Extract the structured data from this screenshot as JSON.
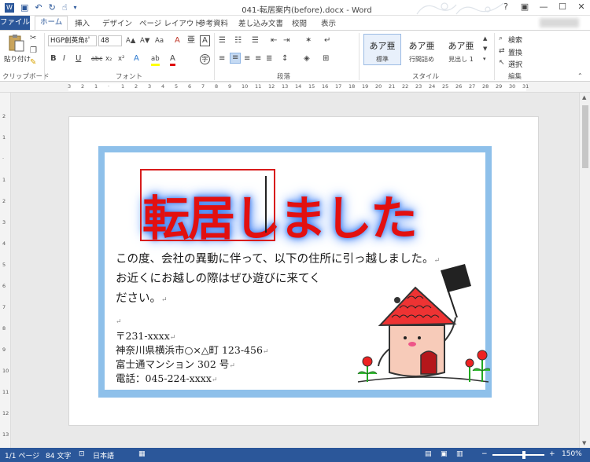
{
  "window": {
    "title": "041-転居案内(before).docx - Word",
    "help": "?",
    "ribbon_display": "▣",
    "minimize": "—",
    "maximize": "☐",
    "close": "✕"
  },
  "qat": {
    "save": "▣",
    "undo": "↶",
    "redo": "↻",
    "touch": "☝",
    "customize": "▾"
  },
  "tabs": [
    "ファイル",
    "ホーム",
    "挿入",
    "デザイン",
    "ページ レイアウト",
    "参考資料",
    "差し込み文書",
    "校閲",
    "表示"
  ],
  "active_tab": "ホーム",
  "ribbon": {
    "clipboard": {
      "paste": "貼り付け",
      "label": "クリップボード"
    },
    "font": {
      "family": "HGP創英角ﾎﾟ",
      "size": "48",
      "label": "フォント",
      "grow": "A▲",
      "shrink": "A▼",
      "case": "Aa",
      "clear": "A",
      "phonetic": "亜",
      "border": "A",
      "bold": "B",
      "italic": "I",
      "underline": "U",
      "strike": "abc",
      "sub": "x₂",
      "sup": "x²",
      "effects": "A",
      "highlight": "ab",
      "color": "A",
      "enclose": "字"
    },
    "paragraph": {
      "label": "段落"
    },
    "styles": {
      "label": "スタイル",
      "items": [
        {
          "sample": "あア亜",
          "name": "標準"
        },
        {
          "sample": "あア亜",
          "name": "行間詰め"
        },
        {
          "sample": "あア亜",
          "name": "見出し 1"
        }
      ]
    },
    "editing": {
      "label": "編集",
      "find": "検索",
      "replace": "置換",
      "select": "選択"
    }
  },
  "ruler": [
    "3",
    "2",
    "1",
    "",
    "1",
    "2",
    "3",
    "4",
    "5",
    "6",
    "7",
    "8",
    "9",
    "10",
    "11",
    "12",
    "13",
    "14",
    "15",
    "16",
    "17",
    "18",
    "19",
    "20",
    "21",
    "22",
    "23",
    "24",
    "25",
    "26",
    "27",
    "28",
    "29",
    "30",
    "31"
  ],
  "vruler": [
    "2",
    "1",
    "",
    "1",
    "2",
    "3",
    "4",
    "5",
    "6",
    "7",
    "8",
    "9",
    "10",
    "11",
    "12",
    "13"
  ],
  "document": {
    "headline": "転居しました",
    "body_line1": "この度、会社の異動に伴って、以下の住所に引っ越しました。",
    "body_line2": "お近くにお越しの際はぜひ遊びに来てく",
    "body_line3": "ださい。",
    "postal": "〒231-xxxx",
    "address": "神奈川県横浜市○×△町 123-456",
    "building": "富士通マンション 302 号",
    "phone": "電話：045-224-xxxx",
    "para_mark": "↵"
  },
  "status": {
    "page": "1/1 ページ",
    "words": "84 文字",
    "lang": "日本語",
    "zoom": "150%",
    "zoom_out": "−",
    "zoom_in": "+"
  },
  "colors": {
    "accent": "#2b579a",
    "frame": "#8ec0ea",
    "headline": "#e21010",
    "glow": "#3f7ff0"
  }
}
